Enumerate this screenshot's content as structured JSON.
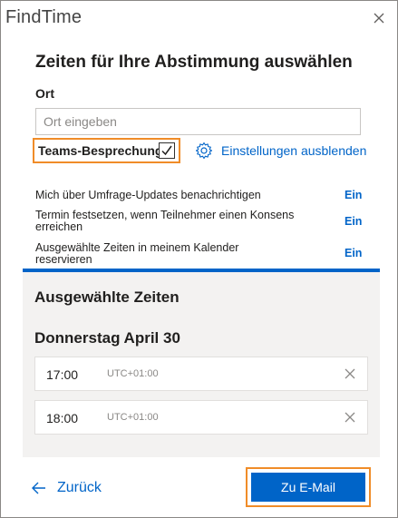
{
  "app": {
    "title": "FindTime"
  },
  "heading": "Zeiten für Ihre Abstimmung auswählen",
  "location": {
    "label": "Ort",
    "placeholder": "Ort eingeben",
    "value": ""
  },
  "teams": {
    "label": "Teams-Besprechung",
    "checked": true
  },
  "settings_link": "Einstellungen ausblenden",
  "options": [
    {
      "label": "Mich über Umfrage-Updates benachrichtigen",
      "toggle": "Ein"
    },
    {
      "label": "Termin festsetzen, wenn Teilnehmer einen Konsens erreichen",
      "toggle": "Ein"
    },
    {
      "label": "Ausgewählte Zeiten in meinem Kalender reservieren",
      "toggle": "Ein"
    }
  ],
  "selected": {
    "title": "Ausgewählte Zeiten",
    "date": "Donnerstag April 30",
    "slots": [
      {
        "time": "17:00",
        "tz": "UTC+01:00"
      },
      {
        "time": "18:00",
        "tz": "UTC+01:00"
      }
    ]
  },
  "footer": {
    "back": "Zurück",
    "email": "Zu E-Mail"
  },
  "colors": {
    "accent": "#0064c8",
    "highlight": "#f08c28",
    "panel": "#f3f2f1"
  }
}
